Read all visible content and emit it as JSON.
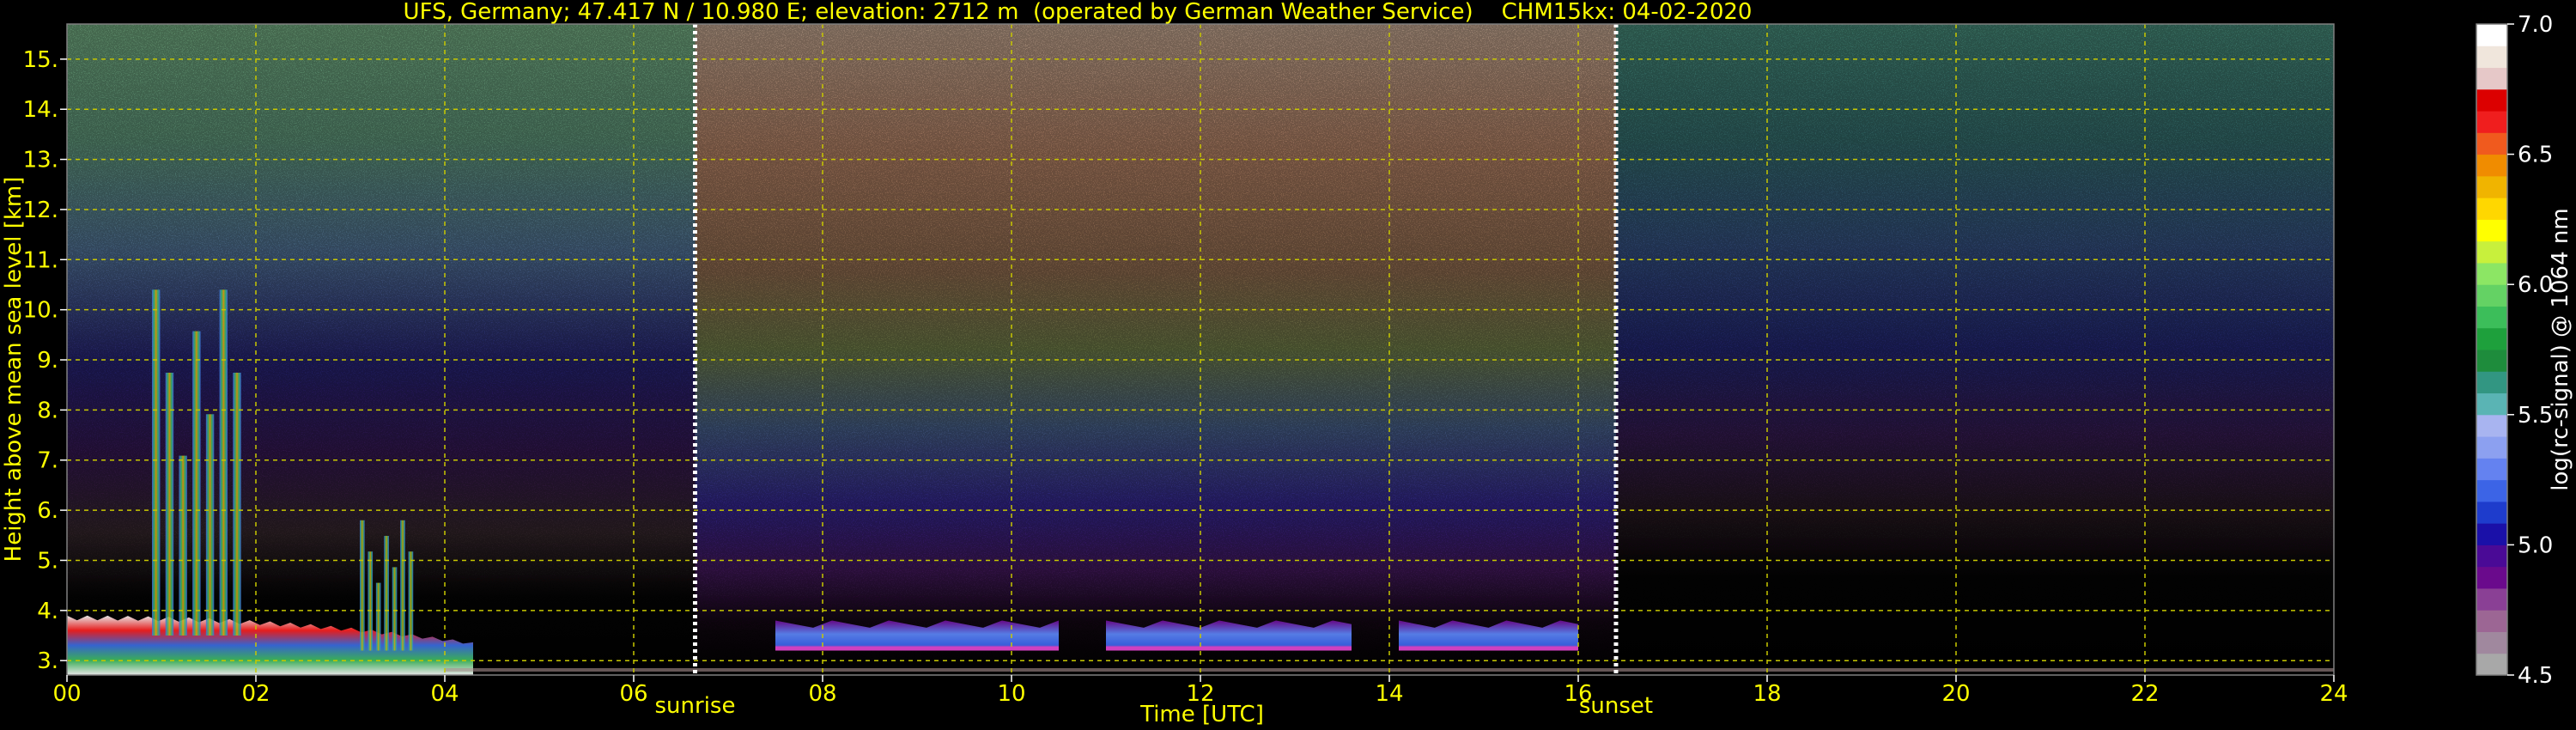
{
  "chart_data": {
    "type": "heatmap",
    "title": "UFS, Germany; 47.417 N / 10.980 E; elevation: 2712 m  (operated by German Weather Service)    CHM15kx: 04-02-2020",
    "xlabel": "Time [UTC]",
    "ylabel": "Height above mean sea level [km]",
    "xlim": [
      0,
      24
    ],
    "ylim": [
      2.712,
      15.7
    ],
    "x_ticks": [
      "00",
      "02",
      "04",
      "06",
      "08",
      "10",
      "12",
      "14",
      "16",
      "18",
      "20",
      "22",
      "24"
    ],
    "x_tick_values": [
      0,
      2,
      4,
      6,
      8,
      10,
      12,
      14,
      16,
      18,
      20,
      22,
      24
    ],
    "y_ticks": [
      "3.",
      "4.",
      "5.",
      "6.",
      "7.",
      "8.",
      "9.",
      "10.",
      "11.",
      "12.",
      "13.",
      "14.",
      "15."
    ],
    "y_tick_values": [
      3,
      4,
      5,
      6,
      7,
      8,
      9,
      10,
      11,
      12,
      13,
      14,
      15
    ],
    "grid": true,
    "markers": [
      {
        "label": "sunrise",
        "time": 6.65
      },
      {
        "label": "sunset",
        "time": 16.4
      }
    ],
    "colorbar": {
      "label": "log(rc-signal) @ 1064 nm",
      "range": [
        4.5,
        7.0
      ],
      "ticks": [
        "4.5",
        "5.0",
        "5.5",
        "6.0",
        "6.5",
        "7.0"
      ],
      "tick_values": [
        4.5,
        5.0,
        5.5,
        6.0,
        6.5,
        7.0
      ],
      "colors": [
        "#a8a8a8",
        "#a0889e",
        "#9c6694",
        "#8a4095",
        "#6a0a8c",
        "#4a0a96",
        "#1a10a8",
        "#1e3ccc",
        "#3c64e6",
        "#6482f0",
        "#8ca0f0",
        "#a8b4f0",
        "#5ab4b4",
        "#329682",
        "#1e8c3c",
        "#1ea03c",
        "#3cbe5a",
        "#64d264",
        "#8ce664",
        "#c8f03c",
        "#ffff00",
        "#ffd700",
        "#f0b400",
        "#f08c00",
        "#f05a1e",
        "#f01e1e",
        "#dc0000",
        "#e6c8c8",
        "#f0e6dc",
        "#ffffff"
      ]
    },
    "signal_regions": [
      {
        "feature": "noise_night",
        "t_start": 0,
        "t_end": 6.65,
        "log_signal": 5.3
      },
      {
        "feature": "noise_day",
        "t_start": 6.65,
        "t_end": 16.4,
        "log_signal": 6.3
      },
      {
        "feature": "noise_night",
        "t_start": 16.4,
        "t_end": 24,
        "log_signal": 5.2
      },
      {
        "feature": "boundary_layer",
        "t_start": 0,
        "t_end": 4.3,
        "h_bottom": 2.712,
        "h_top": 3.9,
        "log_signal": 6.2
      },
      {
        "feature": "cloud",
        "t_start": 0.9,
        "t_end": 1.9,
        "h_bottom": 3.5,
        "h_top": 10.4,
        "log_signal": 5.8
      },
      {
        "feature": "cloud",
        "t_start": 3.1,
        "t_end": 3.7,
        "h_bottom": 3.2,
        "h_top": 5.8,
        "log_signal": 6.0
      },
      {
        "feature": "aerosol_layer",
        "t_start": 7.5,
        "t_end": 10.5,
        "h_bottom": 3.2,
        "h_top": 3.8,
        "log_signal": 5.2
      },
      {
        "feature": "aerosol_layer",
        "t_start": 11.0,
        "t_end": 13.6,
        "h_bottom": 3.2,
        "h_top": 3.8,
        "log_signal": 5.2
      },
      {
        "feature": "aerosol_layer",
        "t_start": 14.1,
        "t_end": 16.0,
        "h_bottom": 3.2,
        "h_top": 3.8,
        "log_signal": 5.0
      }
    ]
  }
}
